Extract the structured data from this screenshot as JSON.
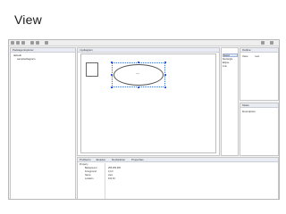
{
  "slide": {
    "title": "View"
  },
  "explorer": {
    "tab": "Package Explorer",
    "items": [
      "default",
      "samplediagram"
    ]
  },
  "editor": {
    "tab": "mydiagram",
    "ellipse_label": "view"
  },
  "palette": {
    "items": [
      "Select",
      "Rectangle",
      "Ellipse",
      "Link"
    ]
  },
  "outline": {
    "tab": "Outline",
    "rows": [
      "View",
      "root"
    ]
  },
  "side2": {
    "tab": "Tasks",
    "rows": [
      "Description"
    ]
  },
  "properties": {
    "tabs": [
      "Problems",
      "Javadoc",
      "Declaration",
      "Properties"
    ],
    "section": "Property",
    "rows": [
      {
        "name": "Background",
        "value": "255,255,255"
      },
      {
        "name": "Foreground",
        "value": "0,0,0"
      },
      {
        "name": "Name",
        "value": "view"
      },
      {
        "name": "Location",
        "value": "100,30"
      }
    ]
  }
}
